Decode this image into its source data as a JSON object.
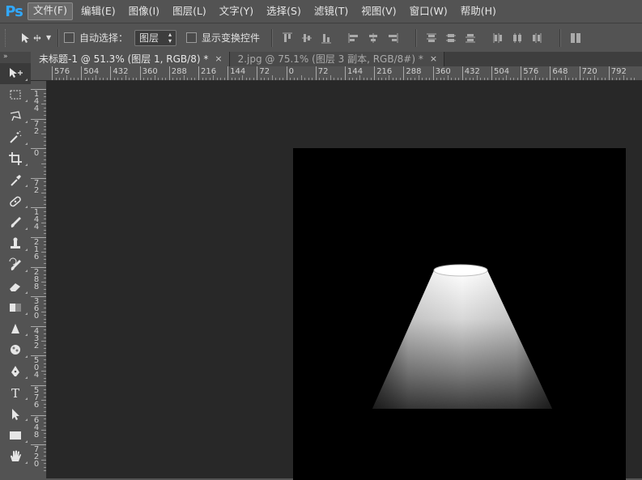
{
  "app": {
    "logo": "Ps"
  },
  "menu": [
    {
      "label": "文件(F)",
      "active": true
    },
    {
      "label": "编辑(E)"
    },
    {
      "label": "图像(I)"
    },
    {
      "label": "图层(L)"
    },
    {
      "label": "文字(Y)"
    },
    {
      "label": "选择(S)"
    },
    {
      "label": "滤镜(T)"
    },
    {
      "label": "视图(V)"
    },
    {
      "label": "窗口(W)"
    },
    {
      "label": "帮助(H)"
    }
  ],
  "options": {
    "auto_select_label": "自动选择：",
    "auto_select_checked": false,
    "auto_select_target": "图层",
    "show_transform_label": "显示变换控件",
    "show_transform_checked": false
  },
  "tabs": [
    {
      "title": "未标题-1 @ 51.3% (图层 1, RGB/8) *",
      "close": "×",
      "active": true
    },
    {
      "title": "2.jpg @ 75.1% (图层 3 副本, RGB/8#) *",
      "close": "×",
      "active": false
    }
  ],
  "ruler_h": [
    "576",
    "504",
    "432",
    "360",
    "288",
    "216",
    "144",
    "72",
    "0",
    "72",
    "144",
    "216",
    "288",
    "360",
    "432",
    "504",
    "576",
    "648",
    "720",
    "792"
  ],
  "ruler_v": [
    [
      "1",
      "4",
      "4"
    ],
    [
      "7",
      "2"
    ],
    [
      "0"
    ],
    [
      "7",
      "2"
    ],
    [
      "1",
      "4",
      "4"
    ],
    [
      "2",
      "1",
      "6"
    ],
    [
      "2",
      "8",
      "8"
    ],
    [
      "3",
      "6",
      "0"
    ],
    [
      "4",
      "3",
      "2"
    ],
    [
      "5",
      "0",
      "4"
    ],
    [
      "5",
      "7",
      "6"
    ],
    [
      "6",
      "4",
      "8"
    ],
    [
      "7",
      "2",
      "0"
    ]
  ],
  "tools": [
    {
      "name": "move-tool-icon",
      "glyph": "move"
    },
    {
      "name": "marquee-tool-icon",
      "glyph": "marquee"
    },
    {
      "name": "lasso-tool-icon",
      "glyph": "lasso"
    },
    {
      "name": "magic-wand-tool-icon",
      "glyph": "wand"
    },
    {
      "name": "crop-tool-icon",
      "glyph": "crop"
    },
    {
      "name": "eyedropper-tool-icon",
      "glyph": "eyedropper"
    },
    {
      "name": "healing-brush-tool-icon",
      "glyph": "healing"
    },
    {
      "name": "brush-tool-icon",
      "glyph": "brush"
    },
    {
      "name": "clone-stamp-tool-icon",
      "glyph": "stamp"
    },
    {
      "name": "history-brush-tool-icon",
      "glyph": "history"
    },
    {
      "name": "eraser-tool-icon",
      "glyph": "eraser"
    },
    {
      "name": "gradient-tool-icon",
      "glyph": "gradient"
    },
    {
      "name": "blur-tool-icon",
      "glyph": "blur"
    },
    {
      "name": "dodge-tool-icon",
      "glyph": "dodge"
    },
    {
      "name": "pen-tool-icon",
      "glyph": "pen"
    },
    {
      "name": "type-tool-icon",
      "glyph": "T"
    },
    {
      "name": "path-selection-tool-icon",
      "glyph": "pathsel"
    },
    {
      "name": "rectangle-tool-icon",
      "glyph": "rect"
    },
    {
      "name": "hand-tool-icon",
      "glyph": "hand"
    }
  ],
  "colors": {
    "accent": "#31a8ff",
    "workspace": "#282828",
    "panel": "#535353",
    "canvas": "#000000"
  }
}
